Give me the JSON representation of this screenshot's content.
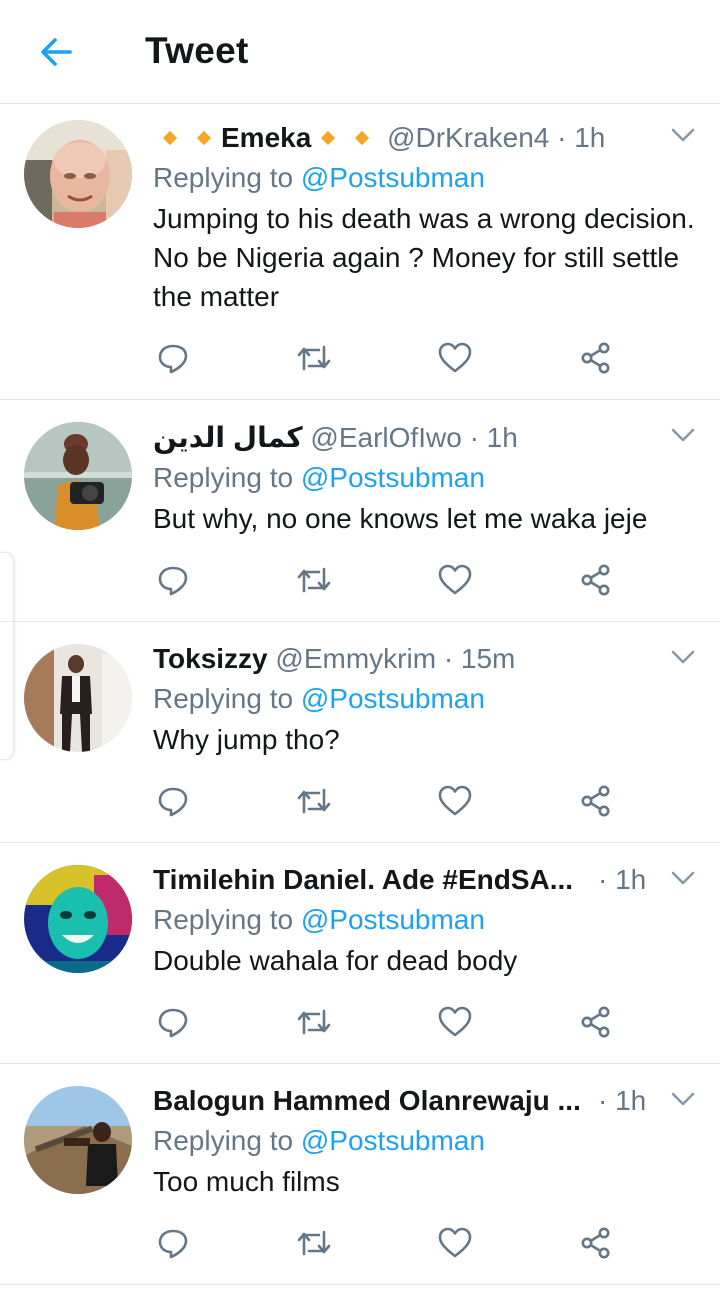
{
  "header": {
    "title": "Tweet"
  },
  "colors": {
    "accent": "#1da1f2",
    "secondary_text": "#657786",
    "primary_text": "#14171a",
    "divider": "#e1e8ed",
    "emoji_diamond": "#f5a623"
  },
  "icons": {
    "back": "arrow-left-icon",
    "more": "chevron-down-icon",
    "reply": "reply-icon",
    "retweet": "retweet-icon",
    "like": "heart-icon",
    "share": "share-icon"
  },
  "tweets": [
    {
      "name": "Emeka",
      "handle": "@DrKraken4",
      "time": "· 1h",
      "replying_prefix": "Replying to",
      "replying_to": "@Postsubman",
      "text": "Jumping to his death was a wrong decision. No be Nigeria again ? Money for still settle the matter"
    },
    {
      "name": "كمال الدين",
      "handle": "@EarlOfIwo",
      "time": "· 1h",
      "replying_prefix": "Replying to",
      "replying_to": "@Postsubman",
      "text": "But why, no one knows let me waka jeje"
    },
    {
      "name": "Toksizzy",
      "handle": "@Emmykrim",
      "time": "· 15m",
      "replying_prefix": "Replying to",
      "replying_to": "@Postsubman",
      "text": "Why jump tho?"
    },
    {
      "name": "Timilehin Daniel. Ade #EndSA...",
      "handle": "",
      "time": "· 1h",
      "replying_prefix": "Replying to",
      "replying_to": "@Postsubman",
      "text": "Double wahala for dead body"
    },
    {
      "name": "Balogun Hammed Olanrewaju ...",
      "handle": "",
      "time": "· 1h",
      "replying_prefix": "Replying to",
      "replying_to": "@Postsubman",
      "text": "Too much films"
    }
  ]
}
